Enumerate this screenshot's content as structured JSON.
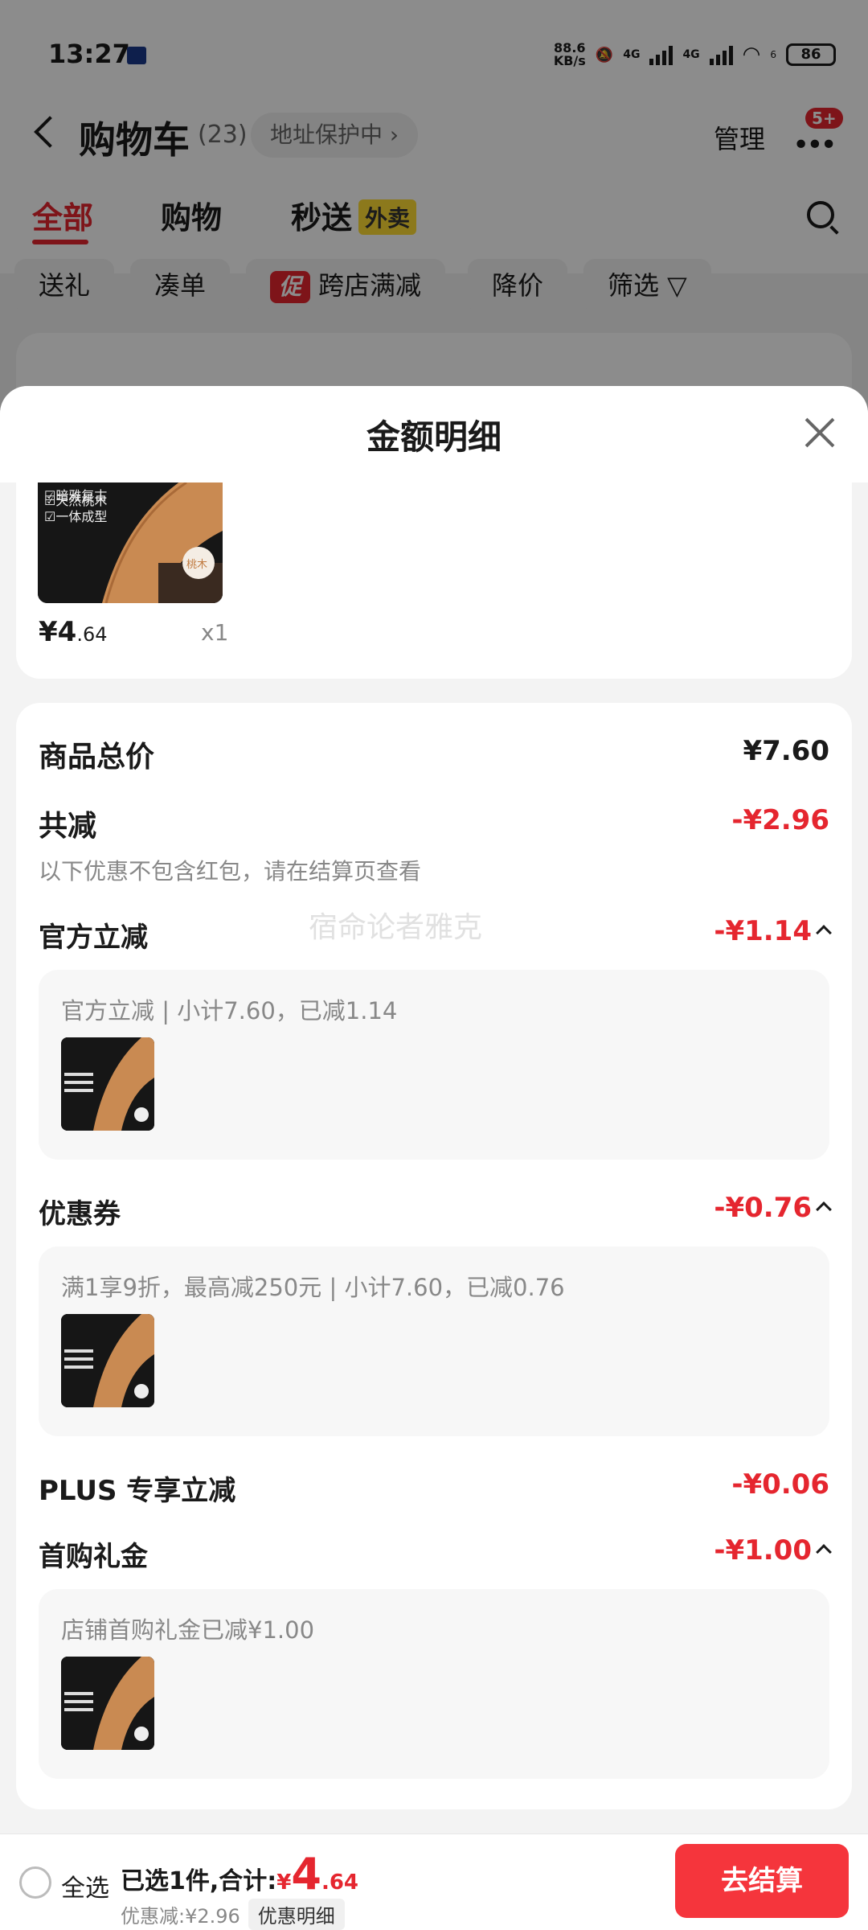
{
  "status_bar": {
    "time": "13:27",
    "net_speed_value": "88.6",
    "net_speed_unit": "KB/s",
    "signal_1_label": "4G",
    "signal_2_label": "4G",
    "wifi_sub": "6",
    "battery": "86"
  },
  "cart": {
    "title": "购物车",
    "count": "(23)",
    "address_pill": "地址保护中 ›",
    "manage": "管理",
    "more_badge": "5+",
    "tabs": [
      {
        "label": "全部"
      },
      {
        "label": "购物"
      },
      {
        "label": "秒送"
      }
    ],
    "tab_badge": "外卖",
    "filters": [
      {
        "label": "送礼"
      },
      {
        "label": "凑单"
      },
      {
        "label": "跨店满减",
        "promo_mark": "促"
      },
      {
        "label": "降价"
      },
      {
        "label": "筛选 ▽"
      }
    ]
  },
  "sheet": {
    "title": "金额明细",
    "product": {
      "image_lines": [
        "☑暗雅复古",
        "☑天然桃木",
        "☑一体成型"
      ],
      "image_badge": "桃木",
      "price_currency": "¥",
      "price_int": "4",
      "price_dec": ".64",
      "quantity": "x1"
    },
    "watermark": "宿命论者雅克",
    "total_label": "商品总价",
    "total_value": "¥7.60",
    "reduce_label": "共减",
    "reduce_value": "-¥2.96",
    "reduce_note": "以下优惠不包含红包，请在结算页查看",
    "items": [
      {
        "label": "官方立减",
        "value": "-¥1.14",
        "detail": "官方立减 | 小计7.60，已减1.14"
      },
      {
        "label": "优惠券",
        "value": "-¥0.76",
        "detail": "满1享9折，最高减250元 | 小计7.60，已减0.76"
      },
      {
        "label": "PLUS 专享立减",
        "value": "-¥0.06"
      },
      {
        "label": "首购礼金",
        "value": "-¥1.00",
        "detail": "店铺首购礼金已减¥1.00"
      }
    ]
  },
  "bottom_bar": {
    "select_all": "全选",
    "summary_prefix": "已选1件,合计:",
    "total_currency": "¥",
    "total_int": "4",
    "total_dec": ".64",
    "discount_text": "优惠减:¥2.96",
    "detail_tag": "优惠明细",
    "checkout": "去结算"
  }
}
